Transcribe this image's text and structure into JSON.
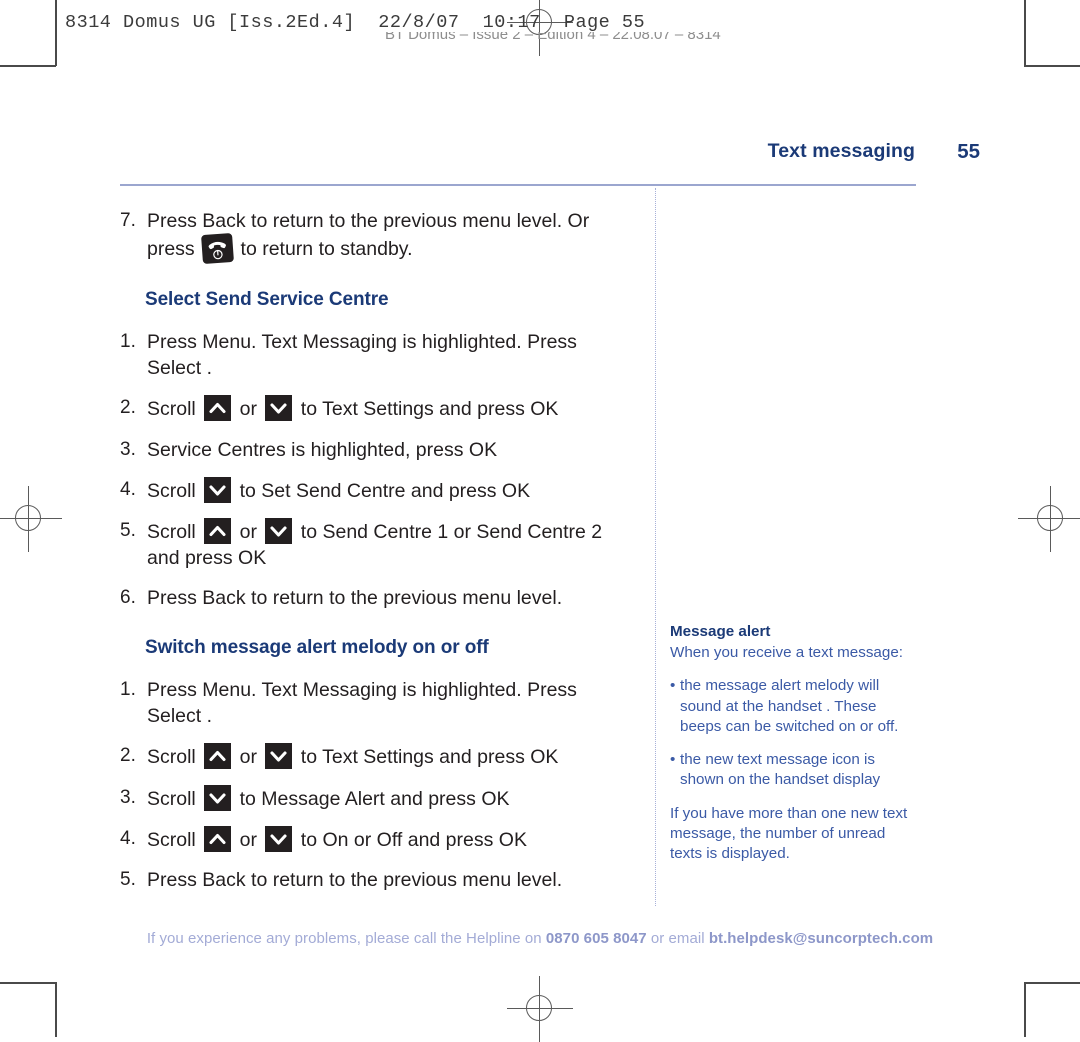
{
  "printer_marks": {
    "slug": "8314 Domus UG [Iss.2Ed.4]  22/8/07  10:17  Page 55",
    "imprint": "BT Domus – Issue 2 – Edition 4 – 22.08.07 – 8314"
  },
  "header": {
    "running_head": "Text messaging",
    "page_number": "55"
  },
  "sections": [
    {
      "heading": null,
      "steps": [
        {
          "number": "7.",
          "parts": [
            {
              "type": "text",
              "value": "Press Back to return to the previous menu level. Or press "
            },
            {
              "type": "key",
              "icon": "end-call-key-icon"
            },
            {
              "type": "text",
              "value": " to return to standby."
            }
          ]
        }
      ]
    },
    {
      "heading": "Select Send Service Centre",
      "steps": [
        {
          "number": "1.",
          "parts": [
            {
              "type": "text",
              "value": "Press Menu. Text  Messaging   is highlighted. Press Select ."
            }
          ]
        },
        {
          "number": "2.",
          "parts": [
            {
              "type": "text",
              "value": "Scroll "
            },
            {
              "type": "key",
              "icon": "scroll-up-key-icon"
            },
            {
              "type": "text",
              "value": " or "
            },
            {
              "type": "key",
              "icon": "scroll-down-key-icon"
            },
            {
              "type": "text",
              "value": " to Text Settings    and press OK"
            }
          ]
        },
        {
          "number": "3.",
          "parts": [
            {
              "type": "text",
              "value": "Service Centres    is highlighted, press OK"
            }
          ]
        },
        {
          "number": "4.",
          "parts": [
            {
              "type": "text",
              "value": "Scroll "
            },
            {
              "type": "key",
              "icon": "scroll-down-key-icon"
            },
            {
              "type": "text",
              "value": " to Set Send Centre  and press OK"
            }
          ]
        },
        {
          "number": "5.",
          "parts": [
            {
              "type": "text",
              "value": "Scroll "
            },
            {
              "type": "key",
              "icon": "scroll-up-key-icon"
            },
            {
              "type": "text",
              "value": " or "
            },
            {
              "type": "key",
              "icon": "scroll-down-key-icon"
            },
            {
              "type": "text",
              "value": " to Send Centre 1  or Send Centre 2   and press OK"
            }
          ]
        },
        {
          "number": "6.",
          "parts": [
            {
              "type": "text",
              "value": "Press Back to return to the previous menu level."
            }
          ]
        }
      ]
    },
    {
      "heading": "Switch message alert melody on or off",
      "steps": [
        {
          "number": "1.",
          "parts": [
            {
              "type": "text",
              "value": "Press Menu. Text  Messaging   is highlighted. Press Select ."
            }
          ]
        },
        {
          "number": "2.",
          "parts": [
            {
              "type": "text",
              "value": "Scroll "
            },
            {
              "type": "key",
              "icon": "scroll-up-key-icon"
            },
            {
              "type": "text",
              "value": " or "
            },
            {
              "type": "key",
              "icon": "scroll-down-key-icon"
            },
            {
              "type": "text",
              "value": " to Text  Settings   and press OK"
            }
          ]
        },
        {
          "number": "3.",
          "parts": [
            {
              "type": "text",
              "value": "Scroll "
            },
            {
              "type": "key",
              "icon": "scroll-down-key-icon"
            },
            {
              "type": "text",
              "value": " to Message Alert   and press OK"
            }
          ]
        },
        {
          "number": "4.",
          "parts": [
            {
              "type": "text",
              "value": "Scroll "
            },
            {
              "type": "key",
              "icon": "scroll-up-key-icon"
            },
            {
              "type": "text",
              "value": " or "
            },
            {
              "type": "key",
              "icon": "scroll-down-key-icon"
            },
            {
              "type": "text",
              "value": " to On or Off  and press OK"
            }
          ]
        },
        {
          "number": "5.",
          "parts": [
            {
              "type": "text",
              "value": "Press Back to return to the previous menu level."
            }
          ]
        }
      ]
    }
  ],
  "sidenote": {
    "title": "Message alert",
    "intro": "When you receive a text message:",
    "bullets": [
      "the message alert melody will sound at the handset . These beeps can be switched on or off.",
      "the new text message icon is shown on the handset display"
    ],
    "outro": "If you have more than one new text message, the number of unread texts is displayed."
  },
  "footer": {
    "lead": "If you experience any problems, please call the Helpline on ",
    "phone": "0870 605 8047",
    "middle": " or email ",
    "email": "bt.helpdesk@suncorptech.com"
  },
  "colors": {
    "heading_blue": "#1b3a77",
    "sidenote_blue": "#3b5aa6",
    "rule_blue": "#9ba6cf",
    "footer_blue": "#a3abd6",
    "key_black": "#231f20"
  }
}
